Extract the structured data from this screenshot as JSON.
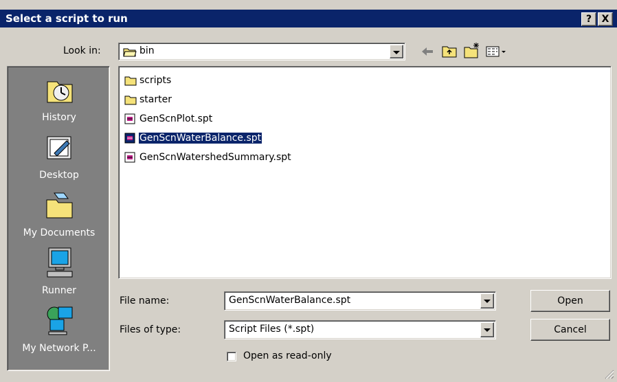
{
  "title": "Select a script to run",
  "title_buttons": {
    "help": "?",
    "close": "X"
  },
  "look_in": {
    "label": "Look in:",
    "value": "bin"
  },
  "places": [
    {
      "label": "History"
    },
    {
      "label": "Desktop"
    },
    {
      "label": "My Documents"
    },
    {
      "label": "Runner"
    },
    {
      "label": "My Network P..."
    }
  ],
  "files": [
    {
      "name": "scripts",
      "type": "folder"
    },
    {
      "name": "starter",
      "type": "folder"
    },
    {
      "name": "GenScnPlot.spt",
      "type": "script"
    },
    {
      "name": "GenScnWaterBalance.spt",
      "type": "script",
      "selected": true
    },
    {
      "name": "GenScnWatershedSummary.spt",
      "type": "script"
    }
  ],
  "file_name": {
    "label": "File name:",
    "value": "GenScnWaterBalance.spt"
  },
  "files_of_type": {
    "label": "Files of type:",
    "value": "Script Files (*.spt)"
  },
  "read_only": {
    "label": "Open as read-only",
    "checked": false
  },
  "buttons": {
    "open": "Open",
    "cancel": "Cancel"
  },
  "colors": {
    "titlebar": "#0a246a",
    "face": "#d4d0c8",
    "places_bg": "#808080",
    "selection": "#0a246a"
  }
}
